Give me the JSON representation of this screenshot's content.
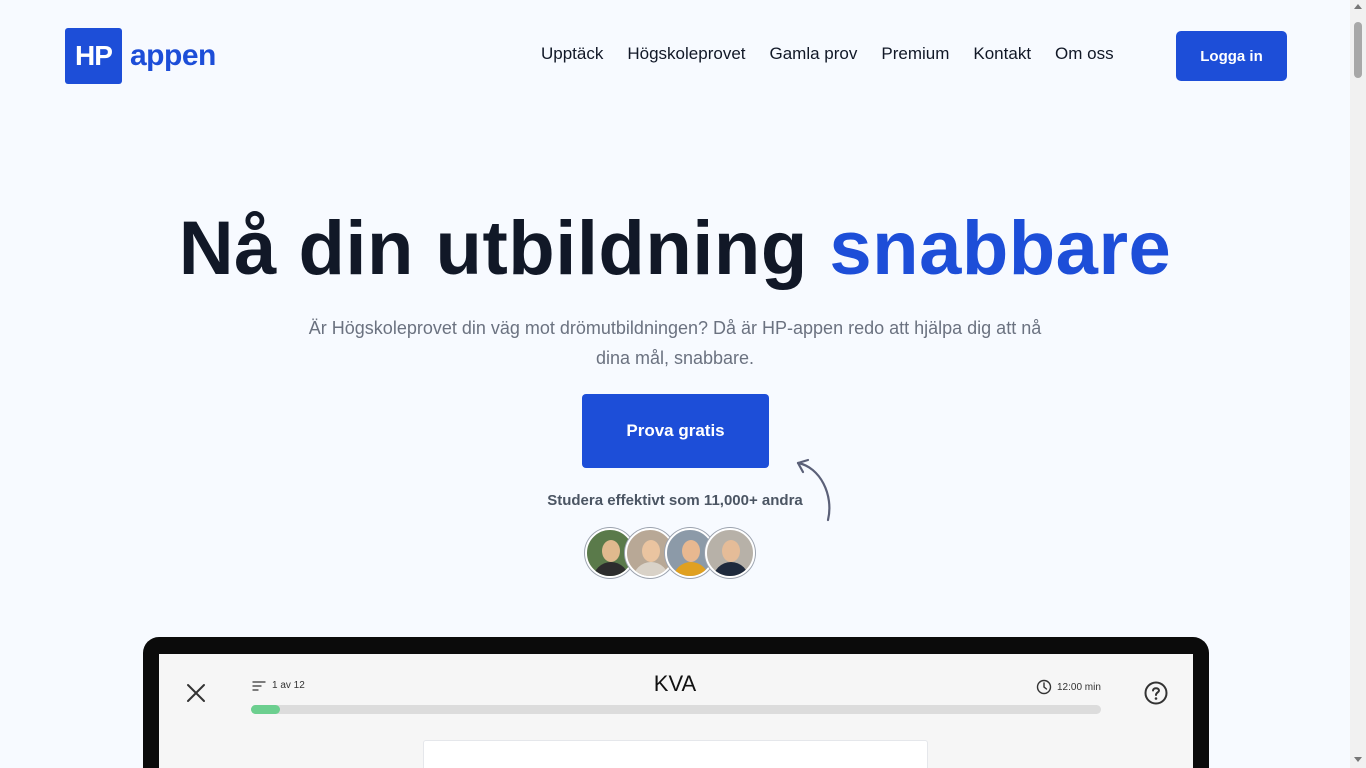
{
  "header": {
    "logo_mark": "HP",
    "logo_word": "appen",
    "nav": [
      {
        "label": "Upptäck"
      },
      {
        "label": "Högskoleprovet"
      },
      {
        "label": "Gamla prov"
      },
      {
        "label": "Premium"
      },
      {
        "label": "Kontakt"
      },
      {
        "label": "Om oss"
      }
    ],
    "login_label": "Logga in"
  },
  "hero": {
    "title_main": "Nå din utbildning",
    "title_accent": "snabbare",
    "subtitle": "Är Högskoleprovet din väg mot drömutbildningen? Då är HP-appen redo att hjälpa dig att nå dina mål, snabbare.",
    "cta_label": "Prova gratis",
    "social_proof": "Studera effektivt som 11,000+ andra"
  },
  "colors": {
    "accent": "#1d4ed8",
    "progress": "#6ccf8f",
    "background": "#f7faff"
  },
  "app_preview": {
    "question_counter": "1 av 12",
    "section": "KVA",
    "timer": "12:00 min",
    "progress_fraction": 0.034,
    "icons": [
      "close-icon",
      "list-icon",
      "clock-icon",
      "help-icon"
    ]
  }
}
